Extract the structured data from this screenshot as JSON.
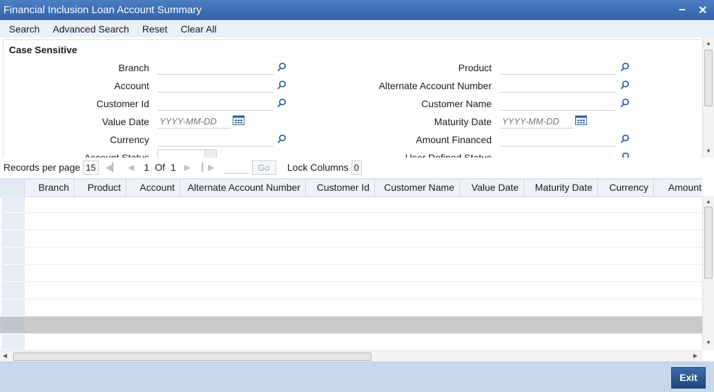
{
  "window": {
    "title": "Financial Inclusion Loan Account Summary",
    "minimize_glyph": "–",
    "close_glyph": "✕"
  },
  "toolbar": {
    "search": "Search",
    "advanced_search": "Advanced Search",
    "reset": "Reset",
    "clear_all": "Clear All"
  },
  "criteria": {
    "section_label": "Case Sensitive",
    "left": [
      {
        "label": "Branch",
        "value": "",
        "lookup": true
      },
      {
        "label": "Account",
        "value": "",
        "lookup": true
      },
      {
        "label": "Customer Id",
        "value": "",
        "lookup": true
      },
      {
        "label": "Value Date",
        "value": "",
        "placeholder": "YYYY-MM-DD",
        "calendar": true
      },
      {
        "label": "Currency",
        "value": "",
        "lookup": true
      },
      {
        "label": "Account Status",
        "value": "",
        "select": true
      }
    ],
    "right": [
      {
        "label": "Product",
        "value": "",
        "lookup": true
      },
      {
        "label": "Alternate Account Number",
        "value": "",
        "lookup": true
      },
      {
        "label": "Customer Name",
        "value": "",
        "lookup": true
      },
      {
        "label": "Maturity Date",
        "value": "",
        "placeholder": "YYYY-MM-DD",
        "calendar": true
      },
      {
        "label": "Amount Financed",
        "value": "",
        "lookup": true
      },
      {
        "label": "User Defined Status",
        "value": "",
        "lookup": true
      }
    ]
  },
  "pager": {
    "records_label": "Records per page",
    "records_value": "15",
    "current_page": "1",
    "of_label": "Of",
    "total_pages": "1",
    "go_label": "Go",
    "lock_label": "Lock Columns",
    "lock_value": "0"
  },
  "grid": {
    "columns": [
      "Branch",
      "Product",
      "Account",
      "Alternate Account Number",
      "Customer Id",
      "Customer Name",
      "Value Date",
      "Maturity Date",
      "Currency",
      "Amount"
    ],
    "row_count": 9,
    "selected_row": 7
  },
  "footer": {
    "exit_label": "Exit"
  },
  "icons": {
    "lookup": "magnifier-icon",
    "calendar": "calendar-icon"
  },
  "colors": {
    "titlebar": "#2f62a6",
    "toolbar": "#e8f0fa",
    "footer": "#c8d8ea",
    "exit_button": "#2f5a93",
    "lens": "#2f62a6"
  }
}
